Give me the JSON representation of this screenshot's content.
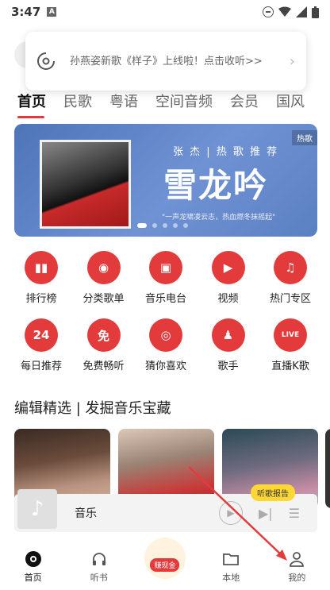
{
  "status": {
    "time": "3:47",
    "a_icon": "A"
  },
  "notification": {
    "text": "孙燕姿新歌《样子》上线啦！点击收听>>"
  },
  "tabs": [
    "首页",
    "民歌",
    "粤语",
    "空间音频",
    "会员",
    "国风"
  ],
  "banner": {
    "tag": "热歌",
    "subtitle": "张 杰  |  热 歌 推 荐",
    "title": "雪龙吟",
    "caption": "\"一声龙啸凌云志，热血燃冬抹摇起\""
  },
  "grid": [
    {
      "label": "排行榜",
      "icon": "bar-chart-icon",
      "glyph": "▮▮"
    },
    {
      "label": "分类歌单",
      "icon": "disc-icon",
      "glyph": "◉"
    },
    {
      "label": "音乐电台",
      "icon": "radio-icon",
      "glyph": "▣"
    },
    {
      "label": "视频",
      "icon": "play-icon",
      "glyph": "▶"
    },
    {
      "label": "热门专区",
      "icon": "music-note-icon",
      "glyph": "♫"
    },
    {
      "label": "每日推荐",
      "icon": "calendar-24-icon",
      "glyph": "24"
    },
    {
      "label": "免费畅听",
      "icon": "free-icon",
      "glyph": "免"
    },
    {
      "label": "猜你喜欢",
      "icon": "target-icon",
      "glyph": "◎"
    },
    {
      "label": "歌手",
      "icon": "singer-icon",
      "glyph": "♟"
    },
    {
      "label": "直播K歌",
      "icon": "live-icon",
      "glyph": "LIVE"
    }
  ],
  "section": {
    "title": "编辑精选 | 发掘音乐宝藏"
  },
  "report_badge": "听歌报告",
  "miniplayer": {
    "title": "音乐"
  },
  "nav": [
    {
      "label": "首页",
      "icon": "home-icon"
    },
    {
      "label": "听书",
      "icon": "headphones-icon"
    },
    {
      "label": "赚现金",
      "icon": "cash-icon"
    },
    {
      "label": "本地",
      "icon": "folder-icon"
    },
    {
      "label": "我的",
      "icon": "profile-icon"
    }
  ],
  "colors": {
    "accent": "#e33b3b",
    "banner": "#5b80c2",
    "badge": "#fdd835"
  }
}
